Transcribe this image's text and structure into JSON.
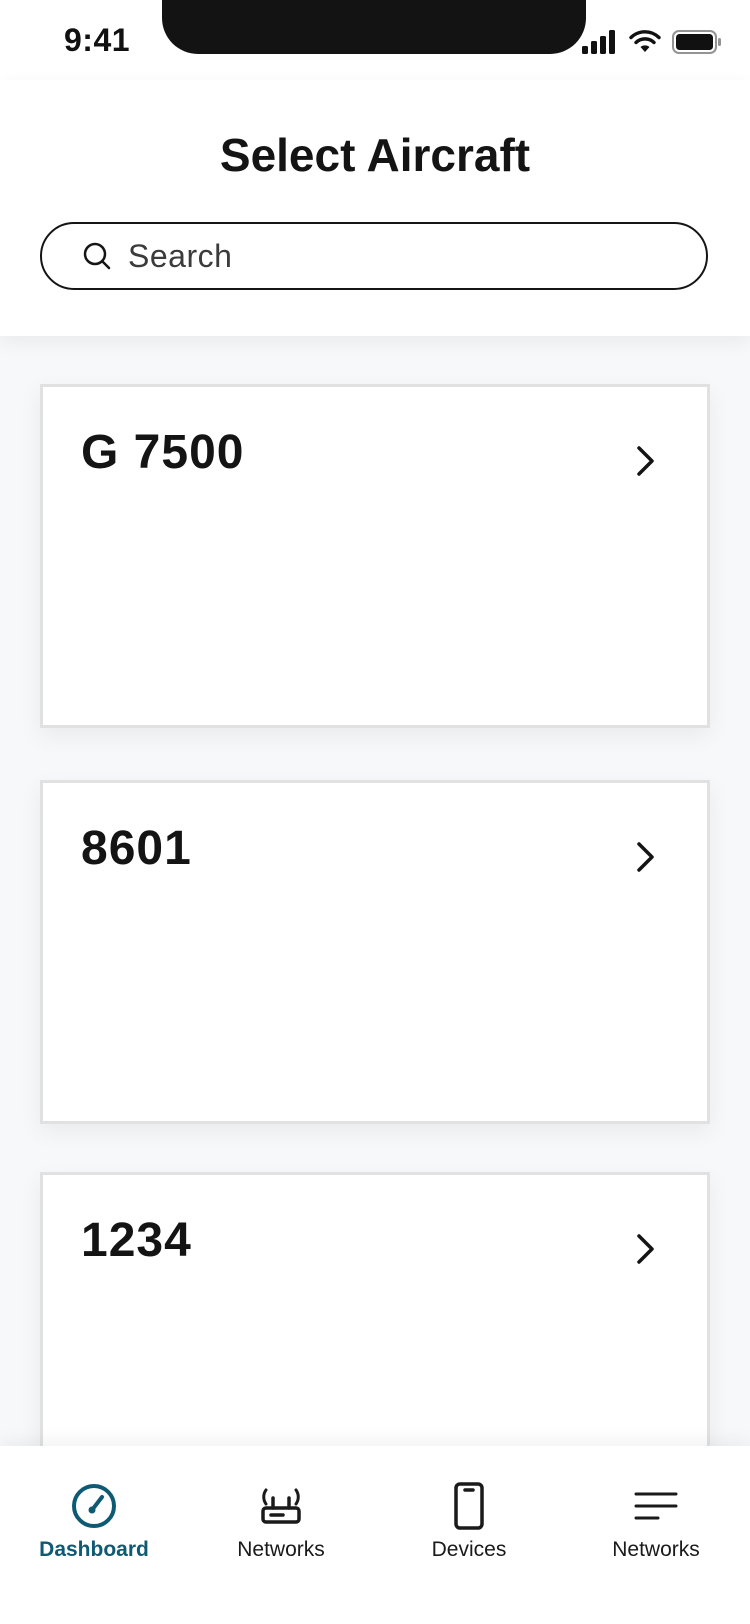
{
  "status_bar": {
    "time": "9:41"
  },
  "header": {
    "title": "Select Aircraft"
  },
  "search": {
    "placeholder": "Search"
  },
  "aircraft": [
    {
      "name": "G 7500"
    },
    {
      "name": "8601"
    },
    {
      "name": "1234"
    }
  ],
  "tabbar": {
    "items": [
      {
        "label": "Dashboard",
        "icon": "speedometer-icon",
        "active": true
      },
      {
        "label": "Networks",
        "icon": "router-icon",
        "active": false
      },
      {
        "label": "Devices",
        "icon": "phone-icon",
        "active": false
      },
      {
        "label": "Networks",
        "icon": "menu-icon",
        "active": false
      }
    ]
  },
  "colors": {
    "accent": "#0e5a73",
    "text": "#141414",
    "card_border": "#e1e1e1",
    "background": "#f7f8fa"
  }
}
